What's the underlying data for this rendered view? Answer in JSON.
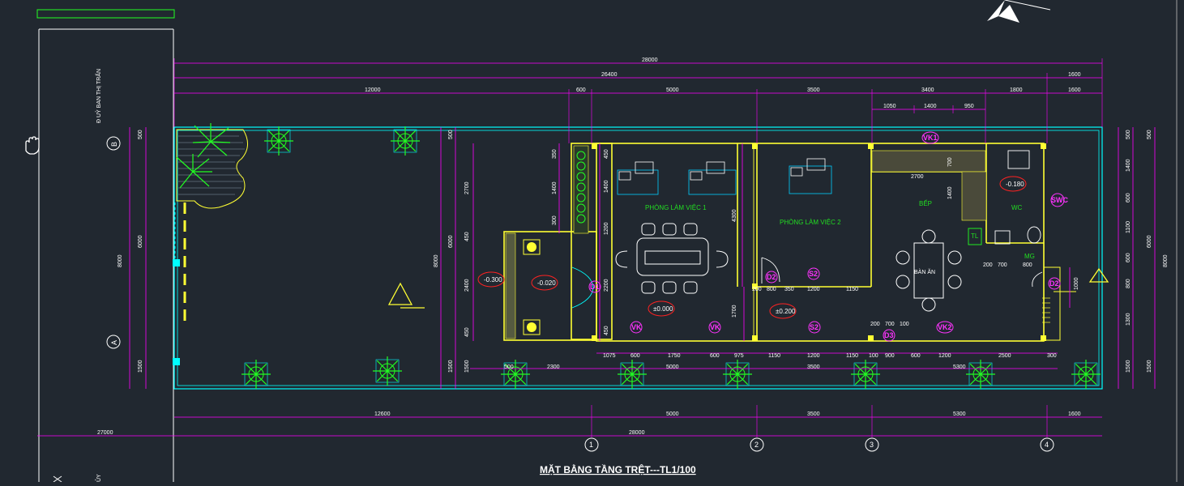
{
  "colors": {
    "background": "#212830",
    "wall": "#ffff33",
    "boundary": "#00ffff",
    "dimension": "#ff00ff",
    "text_room": "#22dd22",
    "plant": "#22ff22",
    "level_tag": "#ff2222"
  },
  "drawing": {
    "title": "MẶT BẰNG TẦNG TRỆT---TL1/100",
    "street_label": "Đ UỶ BAN THỊ TRẤN",
    "side_label": "ỦY"
  },
  "rooms": {
    "work1": "PHÒNG LÀM VIỆC 1",
    "work2": "PHÒNG LÀM VIỆC 2",
    "kitchen": "BẾP",
    "dining": "BÀN ĂN",
    "wc": "WC",
    "tl": "TL",
    "mg": "MG"
  },
  "tags": {
    "vk1": "VK1",
    "vk2": "VK2",
    "vk_a": "VK",
    "vk_b": "VK",
    "d1": "D1",
    "d2a": "D2",
    "d2b": "D2",
    "d3": "D3",
    "s2a": "S2",
    "s2b": "S2",
    "swc": "SWC"
  },
  "levels": {
    "l1": "-0.300",
    "l2": "-0.020",
    "l3": "±0.000",
    "l4": "±0.200",
    "l5": "-0.180"
  },
  "grid": {
    "c1": "1",
    "c2": "2",
    "c3": "3",
    "c4": "4",
    "rA": "A",
    "rB": "B"
  },
  "dims_top": {
    "total1": "28000",
    "total2": "26400",
    "end1": "1600",
    "d_12000": "12000",
    "d_600": "600",
    "d_5000": "5000",
    "d_3500": "3500",
    "d_3400": "3400",
    "d_1800": "1800",
    "d_1600": "1600",
    "d_1050": "1050",
    "d_1400": "1400",
    "d_950": "950"
  },
  "dims_bottom": {
    "d_12600": "12600",
    "d_5000": "5000",
    "d_3500": "3500",
    "d_5300": "5300",
    "d_1600": "1600",
    "total": "28000",
    "left_total": "27000"
  },
  "dims_inner": {
    "b1075": "1075",
    "b600": "600",
    "b1750": "1750",
    "b600b": "600",
    "b975": "975",
    "b1150": "1150",
    "b1200": "1200",
    "b1150b": "1150",
    "b100": "100",
    "b900": "900",
    "b600c": "600",
    "b1200b": "1200",
    "b2500": "2500",
    "b300": "300",
    "b2300": "2300",
    "b5000": "5000",
    "b3500": "3500",
    "b5300": "5300",
    "b200": "200",
    "b500": "500"
  },
  "dims_side": {
    "l500": "500",
    "l6000": "6000",
    "l1500": "1500",
    "l8000": "8000",
    "r500": "500",
    "r1400": "1400",
    "r600": "600",
    "r1100": "1100",
    "r800": "800",
    "r1300": "1300",
    "r1500": "1500",
    "r8000": "8000",
    "i2700": "2700",
    "i450": "450",
    "i2400": "2400",
    "i1400": "1400",
    "i1200": "1200",
    "i2200": "2200",
    "i4300": "4300",
    "i1700": "1700",
    "i350": "350",
    "i300": "300",
    "i1000": "1000"
  },
  "dims_room": {
    "k2700": "2700",
    "k700": "700",
    "k1400": "1400",
    "wc200": "200",
    "wc700": "700",
    "wc800": "800",
    "m800": "800",
    "m350": "350",
    "m1200": "1200",
    "m1150": "1150",
    "m200": "200",
    "m700": "700",
    "m100": "100"
  }
}
